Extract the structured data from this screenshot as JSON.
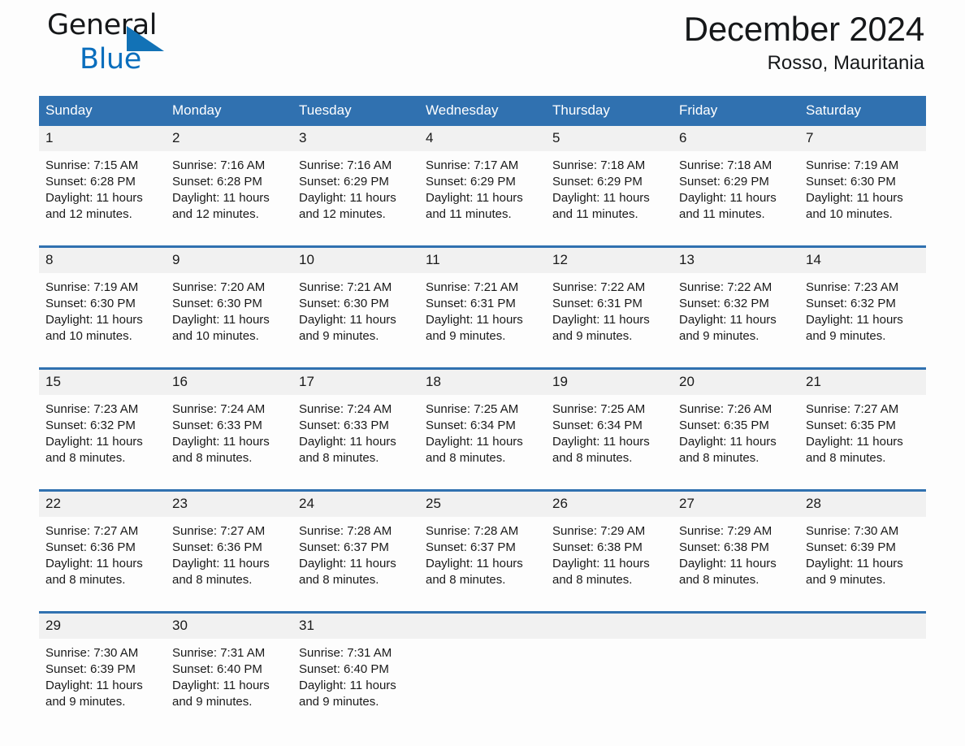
{
  "brand": {
    "name_line1": "General",
    "name_line2": "Blue",
    "accent_color": "#0a6ebd",
    "triangle_color": "#1272b6"
  },
  "header": {
    "title": "December 2024",
    "location": "Rosso, Mauritania"
  },
  "theme": {
    "header_row_bg": "#3071b0",
    "daynum_bg": "#f1f1f1",
    "page_bg": "#fdfdfd",
    "text_color": "#1a1a1a"
  },
  "weekday_headers": [
    "Sunday",
    "Monday",
    "Tuesday",
    "Wednesday",
    "Thursday",
    "Friday",
    "Saturday"
  ],
  "weeks": [
    [
      {
        "day": "1",
        "sunrise": "Sunrise: 7:15 AM",
        "sunset": "Sunset: 6:28 PM",
        "daylight_line1": "Daylight: 11 hours",
        "daylight_line2": "and 12 minutes."
      },
      {
        "day": "2",
        "sunrise": "Sunrise: 7:16 AM",
        "sunset": "Sunset: 6:28 PM",
        "daylight_line1": "Daylight: 11 hours",
        "daylight_line2": "and 12 minutes."
      },
      {
        "day": "3",
        "sunrise": "Sunrise: 7:16 AM",
        "sunset": "Sunset: 6:29 PM",
        "daylight_line1": "Daylight: 11 hours",
        "daylight_line2": "and 12 minutes."
      },
      {
        "day": "4",
        "sunrise": "Sunrise: 7:17 AM",
        "sunset": "Sunset: 6:29 PM",
        "daylight_line1": "Daylight: 11 hours",
        "daylight_line2": "and 11 minutes."
      },
      {
        "day": "5",
        "sunrise": "Sunrise: 7:18 AM",
        "sunset": "Sunset: 6:29 PM",
        "daylight_line1": "Daylight: 11 hours",
        "daylight_line2": "and 11 minutes."
      },
      {
        "day": "6",
        "sunrise": "Sunrise: 7:18 AM",
        "sunset": "Sunset: 6:29 PM",
        "daylight_line1": "Daylight: 11 hours",
        "daylight_line2": "and 11 minutes."
      },
      {
        "day": "7",
        "sunrise": "Sunrise: 7:19 AM",
        "sunset": "Sunset: 6:30 PM",
        "daylight_line1": "Daylight: 11 hours",
        "daylight_line2": "and 10 minutes."
      }
    ],
    [
      {
        "day": "8",
        "sunrise": "Sunrise: 7:19 AM",
        "sunset": "Sunset: 6:30 PM",
        "daylight_line1": "Daylight: 11 hours",
        "daylight_line2": "and 10 minutes."
      },
      {
        "day": "9",
        "sunrise": "Sunrise: 7:20 AM",
        "sunset": "Sunset: 6:30 PM",
        "daylight_line1": "Daylight: 11 hours",
        "daylight_line2": "and 10 minutes."
      },
      {
        "day": "10",
        "sunrise": "Sunrise: 7:21 AM",
        "sunset": "Sunset: 6:30 PM",
        "daylight_line1": "Daylight: 11 hours",
        "daylight_line2": "and 9 minutes."
      },
      {
        "day": "11",
        "sunrise": "Sunrise: 7:21 AM",
        "sunset": "Sunset: 6:31 PM",
        "daylight_line1": "Daylight: 11 hours",
        "daylight_line2": "and 9 minutes."
      },
      {
        "day": "12",
        "sunrise": "Sunrise: 7:22 AM",
        "sunset": "Sunset: 6:31 PM",
        "daylight_line1": "Daylight: 11 hours",
        "daylight_line2": "and 9 minutes."
      },
      {
        "day": "13",
        "sunrise": "Sunrise: 7:22 AM",
        "sunset": "Sunset: 6:32 PM",
        "daylight_line1": "Daylight: 11 hours",
        "daylight_line2": "and 9 minutes."
      },
      {
        "day": "14",
        "sunrise": "Sunrise: 7:23 AM",
        "sunset": "Sunset: 6:32 PM",
        "daylight_line1": "Daylight: 11 hours",
        "daylight_line2": "and 9 minutes."
      }
    ],
    [
      {
        "day": "15",
        "sunrise": "Sunrise: 7:23 AM",
        "sunset": "Sunset: 6:32 PM",
        "daylight_line1": "Daylight: 11 hours",
        "daylight_line2": "and 8 minutes."
      },
      {
        "day": "16",
        "sunrise": "Sunrise: 7:24 AM",
        "sunset": "Sunset: 6:33 PM",
        "daylight_line1": "Daylight: 11 hours",
        "daylight_line2": "and 8 minutes."
      },
      {
        "day": "17",
        "sunrise": "Sunrise: 7:24 AM",
        "sunset": "Sunset: 6:33 PM",
        "daylight_line1": "Daylight: 11 hours",
        "daylight_line2": "and 8 minutes."
      },
      {
        "day": "18",
        "sunrise": "Sunrise: 7:25 AM",
        "sunset": "Sunset: 6:34 PM",
        "daylight_line1": "Daylight: 11 hours",
        "daylight_line2": "and 8 minutes."
      },
      {
        "day": "19",
        "sunrise": "Sunrise: 7:25 AM",
        "sunset": "Sunset: 6:34 PM",
        "daylight_line1": "Daylight: 11 hours",
        "daylight_line2": "and 8 minutes."
      },
      {
        "day": "20",
        "sunrise": "Sunrise: 7:26 AM",
        "sunset": "Sunset: 6:35 PM",
        "daylight_line1": "Daylight: 11 hours",
        "daylight_line2": "and 8 minutes."
      },
      {
        "day": "21",
        "sunrise": "Sunrise: 7:27 AM",
        "sunset": "Sunset: 6:35 PM",
        "daylight_line1": "Daylight: 11 hours",
        "daylight_line2": "and 8 minutes."
      }
    ],
    [
      {
        "day": "22",
        "sunrise": "Sunrise: 7:27 AM",
        "sunset": "Sunset: 6:36 PM",
        "daylight_line1": "Daylight: 11 hours",
        "daylight_line2": "and 8 minutes."
      },
      {
        "day": "23",
        "sunrise": "Sunrise: 7:27 AM",
        "sunset": "Sunset: 6:36 PM",
        "daylight_line1": "Daylight: 11 hours",
        "daylight_line2": "and 8 minutes."
      },
      {
        "day": "24",
        "sunrise": "Sunrise: 7:28 AM",
        "sunset": "Sunset: 6:37 PM",
        "daylight_line1": "Daylight: 11 hours",
        "daylight_line2": "and 8 minutes."
      },
      {
        "day": "25",
        "sunrise": "Sunrise: 7:28 AM",
        "sunset": "Sunset: 6:37 PM",
        "daylight_line1": "Daylight: 11 hours",
        "daylight_line2": "and 8 minutes."
      },
      {
        "day": "26",
        "sunrise": "Sunrise: 7:29 AM",
        "sunset": "Sunset: 6:38 PM",
        "daylight_line1": "Daylight: 11 hours",
        "daylight_line2": "and 8 minutes."
      },
      {
        "day": "27",
        "sunrise": "Sunrise: 7:29 AM",
        "sunset": "Sunset: 6:38 PM",
        "daylight_line1": "Daylight: 11 hours",
        "daylight_line2": "and 8 minutes."
      },
      {
        "day": "28",
        "sunrise": "Sunrise: 7:30 AM",
        "sunset": "Sunset: 6:39 PM",
        "daylight_line1": "Daylight: 11 hours",
        "daylight_line2": "and 9 minutes."
      }
    ],
    [
      {
        "day": "29",
        "sunrise": "Sunrise: 7:30 AM",
        "sunset": "Sunset: 6:39 PM",
        "daylight_line1": "Daylight: 11 hours",
        "daylight_line2": "and 9 minutes."
      },
      {
        "day": "30",
        "sunrise": "Sunrise: 7:31 AM",
        "sunset": "Sunset: 6:40 PM",
        "daylight_line1": "Daylight: 11 hours",
        "daylight_line2": "and 9 minutes."
      },
      {
        "day": "31",
        "sunrise": "Sunrise: 7:31 AM",
        "sunset": "Sunset: 6:40 PM",
        "daylight_line1": "Daylight: 11 hours",
        "daylight_line2": "and 9 minutes."
      },
      {
        "day": "",
        "sunrise": "",
        "sunset": "",
        "daylight_line1": "",
        "daylight_line2": ""
      },
      {
        "day": "",
        "sunrise": "",
        "sunset": "",
        "daylight_line1": "",
        "daylight_line2": ""
      },
      {
        "day": "",
        "sunrise": "",
        "sunset": "",
        "daylight_line1": "",
        "daylight_line2": ""
      },
      {
        "day": "",
        "sunrise": "",
        "sunset": "",
        "daylight_line1": "",
        "daylight_line2": ""
      }
    ]
  ]
}
